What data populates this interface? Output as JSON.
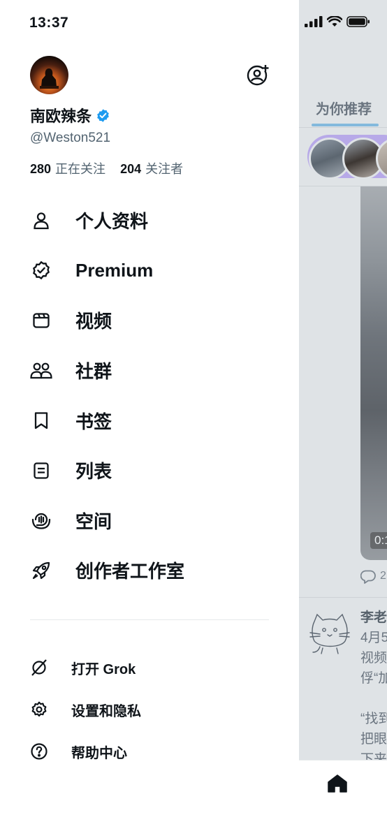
{
  "status_bar": {
    "time": "13:37"
  },
  "profile": {
    "display_name": "南欧辣条",
    "handle": "@Weston521",
    "following_count": "280",
    "following_label": "正在关注",
    "followers_count": "204",
    "followers_label": "关注者"
  },
  "menu": [
    {
      "label": "个人资料",
      "icon": "person-icon"
    },
    {
      "label": "Premium",
      "icon": "verified-badge-icon"
    },
    {
      "label": "视频",
      "icon": "video-icon"
    },
    {
      "label": "社群",
      "icon": "communities-icon"
    },
    {
      "label": "书签",
      "icon": "bookmark-icon"
    },
    {
      "label": "列表",
      "icon": "list-icon"
    },
    {
      "label": "空间",
      "icon": "spaces-icon"
    },
    {
      "label": "创作者工作室",
      "icon": "rocket-icon"
    }
  ],
  "secondary_menu": [
    {
      "label": "打开 Grok",
      "icon": "grok-icon"
    },
    {
      "label": "设置和隐私",
      "icon": "gear-icon"
    },
    {
      "label": "帮助中心",
      "icon": "help-icon"
    }
  ],
  "timeline": {
    "tab_label": "为你推荐",
    "video_time": "0:1",
    "reply_count": "2",
    "post_lines": [
      "李老",
      "4月5",
      "视频",
      "俘“加",
      "",
      "“找到",
      "把眼",
      "下来"
    ]
  },
  "colors": {
    "verified": "#1d9bf0",
    "accent_underline": "#84b9dc",
    "muted": "#536471"
  }
}
